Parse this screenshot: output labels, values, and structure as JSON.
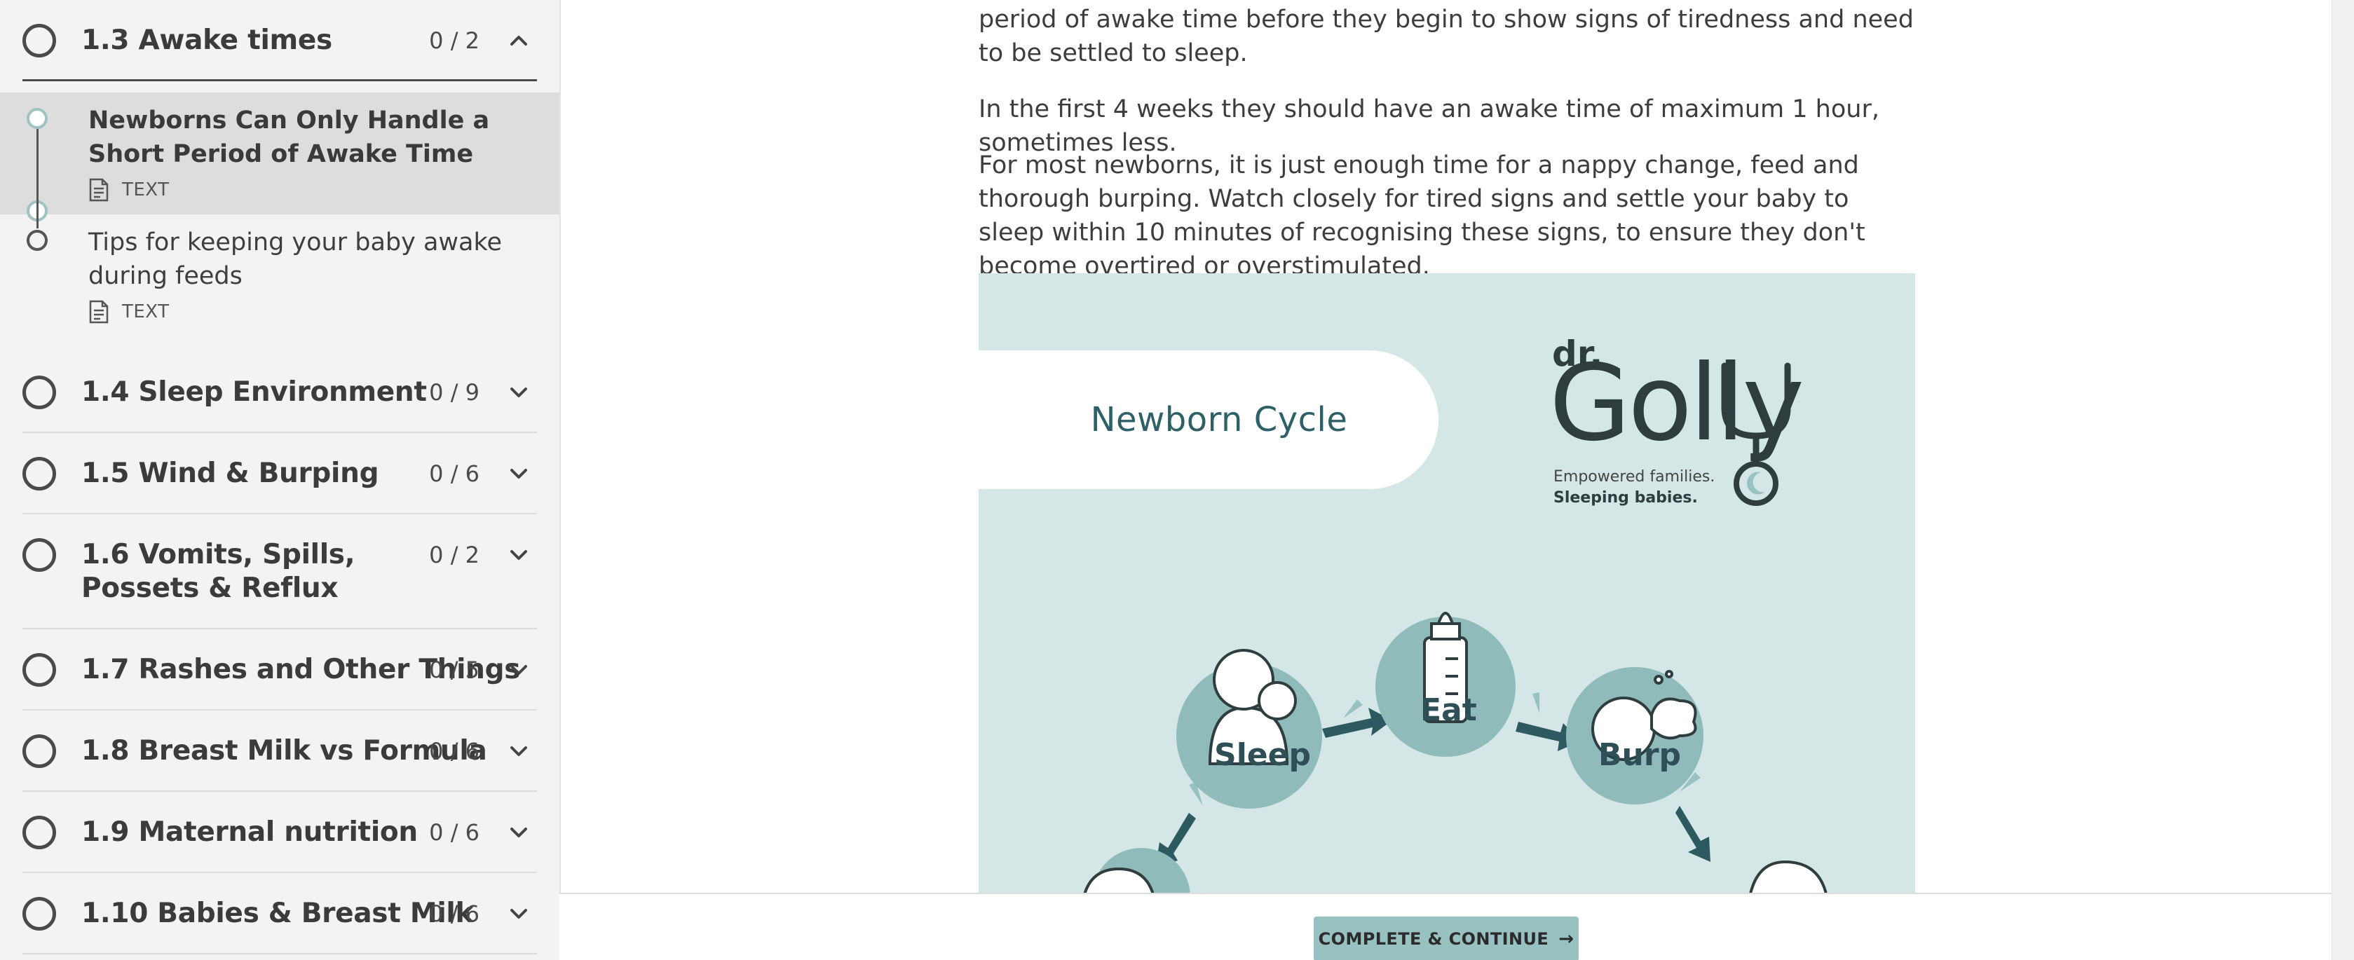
{
  "sidebar": {
    "open_section": {
      "title": "1.3 Awake times",
      "count": "0 / 2"
    },
    "lessons": [
      {
        "title": "Newborns Can Only Handle a Short Period of Awake Time",
        "type": "TEXT"
      },
      {
        "title": "Tips for keeping your baby awake during feeds",
        "type": "TEXT"
      }
    ],
    "sections": [
      {
        "title": "1.4 Sleep Environment",
        "count": "0 / 9"
      },
      {
        "title": "1.5 Wind & Burping",
        "count": "0 / 6"
      },
      {
        "title": "1.6 Vomits, Spills, Possets & Reflux",
        "count": "0 / 2"
      },
      {
        "title": "1.7 Rashes and Other Things",
        "count": "0 / 5"
      },
      {
        "title": "1.8 Breast Milk vs Formula",
        "count": "0 / 6"
      },
      {
        "title": "1.9 Maternal nutrition",
        "count": "0 / 6"
      },
      {
        "title": "1.10 Babies & Breast Milk",
        "count": "0 / 6"
      }
    ]
  },
  "main": {
    "para1": "period of awake time before they begin to show signs of tiredness and need to be settled to sleep.",
    "para2": "In the first 4 weeks they should have an awake time of maximum 1 hour, sometimes less.",
    "para3": "For most newborns, it is just enough time for a nappy change, feed and thorough burping. Watch closely for tired signs and settle your baby to sleep within 10 minutes of recognising these signs, to ensure they don't become overtired or overstimulated.",
    "infographic": {
      "cycle_title": "Newborn Cycle",
      "logo_dr": "dr.",
      "logo_name": "Golly",
      "tagline_1": "Empowered families.",
      "tagline_2": "Sleeping babies.",
      "nodes": [
        "Sleep",
        "Eat",
        "Burp"
      ]
    }
  },
  "footer": {
    "button_label": "COMPLETE & CONTINUE",
    "button_arrow": "→"
  },
  "colors": {
    "accent": "#97c2c1",
    "infographic_bg": "#d4e7e6",
    "dark_teal": "#2d4f55"
  }
}
